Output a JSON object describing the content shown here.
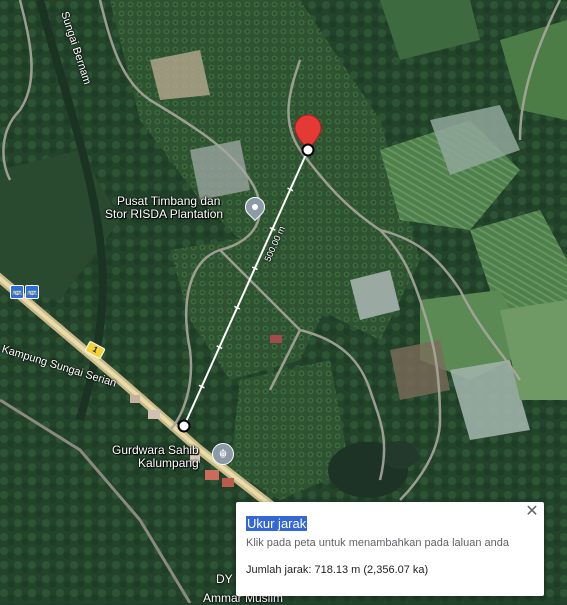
{
  "map": {
    "places": {
      "pusat_timbang_line1": "Pusat Timbang dan",
      "pusat_timbang_line2": "Stor RISDA Plantation",
      "gurdwara_line1": "Gurdwara Sahib",
      "gurdwara_line2": "Kalumpang",
      "bottom_partial_1": "DY",
      "bottom_partial_2": "Ammar Muslim"
    },
    "roads": {
      "sungai_bernam": "Sungai Bernam",
      "kampung_sungai_serian": "Kampung Sungai Serian",
      "route_number": "1"
    },
    "measurement": {
      "segment_label": "500.00 m"
    },
    "icons": {
      "destination_pin": "red-location-pin-icon",
      "poi_marker": "map-poi-icon",
      "temple": "gurdwara-icon",
      "bus_stop": "bus-stop-icon"
    },
    "colors": {
      "pin": "#e53935",
      "measure_line": "#ffffff",
      "highlight": "#3367d6"
    }
  },
  "measure_panel": {
    "title": "Ukur jarak",
    "hint": "Klik pada peta untuk menambahkan pada laluan anda",
    "total": "Jumlah jarak: 718.13 m (2,356.07 ka)",
    "close_icon": "close-icon"
  }
}
